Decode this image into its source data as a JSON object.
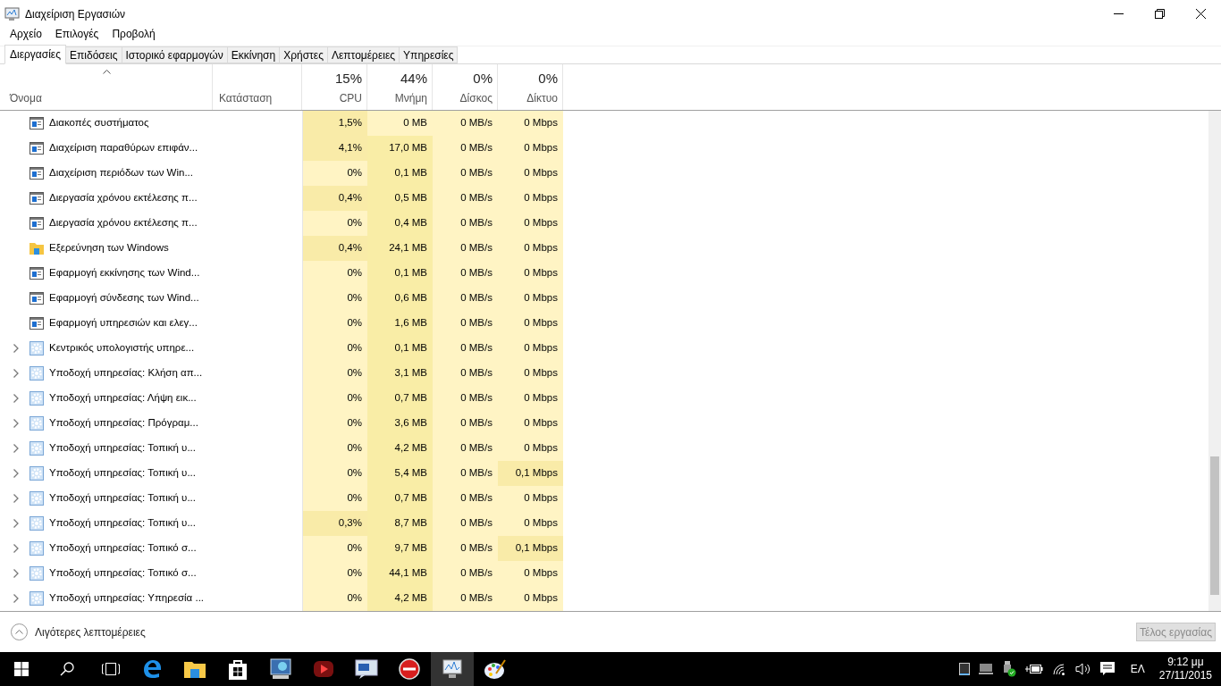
{
  "window": {
    "title": "Διαχείριση Εργασιών"
  },
  "menu": [
    "Αρχείο",
    "Επιλογές",
    "Προβολή"
  ],
  "tabs": [
    {
      "label": "Διεργασίες",
      "selected": true
    },
    {
      "label": "Επιδόσεις",
      "selected": false
    },
    {
      "label": "Ιστορικό εφαρμογών",
      "selected": false
    },
    {
      "label": "Εκκίνηση",
      "selected": false
    },
    {
      "label": "Χρήστες",
      "selected": false
    },
    {
      "label": "Λεπτομέρειες",
      "selected": false
    },
    {
      "label": "Υπηρεσίες",
      "selected": false
    }
  ],
  "columns": [
    {
      "label": "Όνομα",
      "kind": "name"
    },
    {
      "label": "Κατάσταση",
      "kind": "status"
    },
    {
      "label": "CPU",
      "usage": "15%",
      "kind": "metric"
    },
    {
      "label": "Μνήμη",
      "usage": "44%",
      "kind": "metric"
    },
    {
      "label": "Δίσκος",
      "usage": "0%",
      "kind": "metric"
    },
    {
      "label": "Δίκτυο",
      "usage": "0%",
      "kind": "metric"
    }
  ],
  "rows": [
    {
      "kind": "window",
      "name": "Διακοπές συστήματος",
      "cells": [
        {
          "text": "1,5%",
          "highlighted": true
        },
        {
          "text": "0 MB",
          "highlighted": false
        },
        {
          "text": "0 MB/s",
          "highlighted": false
        },
        {
          "text": "0 Mbps",
          "highlighted": false
        }
      ]
    },
    {
      "kind": "window",
      "name": "Διαχείριση παραθύρων επιφάν...",
      "cells": [
        {
          "text": "4,1%",
          "highlighted": true
        },
        {
          "text": "17,0 MB",
          "highlighted": true
        },
        {
          "text": "0 MB/s",
          "highlighted": false
        },
        {
          "text": "0 Mbps",
          "highlighted": false
        }
      ]
    },
    {
      "kind": "window",
      "name": "Διαχείριση περιόδων των Win...",
      "cells": [
        {
          "text": "0%",
          "highlighted": false
        },
        {
          "text": "0,1 MB",
          "highlighted": true
        },
        {
          "text": "0 MB/s",
          "highlighted": false
        },
        {
          "text": "0 Mbps",
          "highlighted": false
        }
      ]
    },
    {
      "kind": "window",
      "name": "Διεργασία χρόνου εκτέλεσης π...",
      "cells": [
        {
          "text": "0,4%",
          "highlighted": true
        },
        {
          "text": "0,5 MB",
          "highlighted": true
        },
        {
          "text": "0 MB/s",
          "highlighted": false
        },
        {
          "text": "0 Mbps",
          "highlighted": false
        }
      ]
    },
    {
      "kind": "window",
      "name": "Διεργασία χρόνου εκτέλεσης π...",
      "cells": [
        {
          "text": "0%",
          "highlighted": false
        },
        {
          "text": "0,4 MB",
          "highlighted": true
        },
        {
          "text": "0 MB/s",
          "highlighted": false
        },
        {
          "text": "0 Mbps",
          "highlighted": false
        }
      ]
    },
    {
      "kind": "folder",
      "name": "Εξερεύνηση των Windows",
      "cells": [
        {
          "text": "0,4%",
          "highlighted": true
        },
        {
          "text": "24,1 MB",
          "highlighted": true
        },
        {
          "text": "0 MB/s",
          "highlighted": false
        },
        {
          "text": "0 Mbps",
          "highlighted": false
        }
      ]
    },
    {
      "kind": "window",
      "name": "Εφαρμογή εκκίνησης των Wind...",
      "cells": [
        {
          "text": "0%",
          "highlighted": false
        },
        {
          "text": "0,1 MB",
          "highlighted": true
        },
        {
          "text": "0 MB/s",
          "highlighted": false
        },
        {
          "text": "0 Mbps",
          "highlighted": false
        }
      ]
    },
    {
      "kind": "window",
      "name": "Εφαρμογή σύνδεσης των Wind...",
      "cells": [
        {
          "text": "0%",
          "highlighted": false
        },
        {
          "text": "0,6 MB",
          "highlighted": true
        },
        {
          "text": "0 MB/s",
          "highlighted": false
        },
        {
          "text": "0 Mbps",
          "highlighted": false
        }
      ]
    },
    {
      "kind": "window",
      "name": "Εφαρμογή υπηρεσιών και ελεγ...",
      "cells": [
        {
          "text": "0%",
          "highlighted": false
        },
        {
          "text": "1,6 MB",
          "highlighted": true
        },
        {
          "text": "0 MB/s",
          "highlighted": false
        },
        {
          "text": "0 Mbps",
          "highlighted": false
        }
      ]
    },
    {
      "kind": "service",
      "expanded": false,
      "name": "Κεντρικός υπολογιστής υπηρε...",
      "cells": [
        {
          "text": "0%",
          "highlighted": false
        },
        {
          "text": "0,1 MB",
          "highlighted": true
        },
        {
          "text": "0 MB/s",
          "highlighted": false
        },
        {
          "text": "0 Mbps",
          "highlighted": false
        }
      ]
    },
    {
      "kind": "service",
      "expanded": false,
      "name": "Υποδοχή υπηρεσίας: Κλήση απ...",
      "cells": [
        {
          "text": "0%",
          "highlighted": false
        },
        {
          "text": "3,1 MB",
          "highlighted": true
        },
        {
          "text": "0 MB/s",
          "highlighted": false
        },
        {
          "text": "0 Mbps",
          "highlighted": false
        }
      ]
    },
    {
      "kind": "service",
      "expanded": false,
      "name": "Υποδοχή υπηρεσίας: Λήψη εικ...",
      "cells": [
        {
          "text": "0%",
          "highlighted": false
        },
        {
          "text": "0,7 MB",
          "highlighted": true
        },
        {
          "text": "0 MB/s",
          "highlighted": false
        },
        {
          "text": "0 Mbps",
          "highlighted": false
        }
      ]
    },
    {
      "kind": "service",
      "expanded": false,
      "name": "Υποδοχή υπηρεσίας: Πρόγραμ...",
      "cells": [
        {
          "text": "0%",
          "highlighted": false
        },
        {
          "text": "3,6 MB",
          "highlighted": true
        },
        {
          "text": "0 MB/s",
          "highlighted": false
        },
        {
          "text": "0 Mbps",
          "highlighted": false
        }
      ]
    },
    {
      "kind": "service",
      "expanded": false,
      "name": "Υποδοχή υπηρεσίας: Τοπική υ...",
      "cells": [
        {
          "text": "0%",
          "highlighted": false
        },
        {
          "text": "4,2 MB",
          "highlighted": true
        },
        {
          "text": "0 MB/s",
          "highlighted": false
        },
        {
          "text": "0 Mbps",
          "highlighted": false
        }
      ]
    },
    {
      "kind": "service",
      "expanded": false,
      "name": "Υποδοχή υπηρεσίας: Τοπική υ...",
      "cells": [
        {
          "text": "0%",
          "highlighted": false
        },
        {
          "text": "5,4 MB",
          "highlighted": true
        },
        {
          "text": "0 MB/s",
          "highlighted": false
        },
        {
          "text": "0,1 Mbps",
          "highlighted": true
        }
      ]
    },
    {
      "kind": "service",
      "expanded": false,
      "name": "Υποδοχή υπηρεσίας: Τοπική υ...",
      "cells": [
        {
          "text": "0%",
          "highlighted": false
        },
        {
          "text": "0,7 MB",
          "highlighted": true
        },
        {
          "text": "0 MB/s",
          "highlighted": false
        },
        {
          "text": "0 Mbps",
          "highlighted": false
        }
      ]
    },
    {
      "kind": "service",
      "expanded": false,
      "name": "Υποδοχή υπηρεσίας: Τοπική υ...",
      "cells": [
        {
          "text": "0,3%",
          "highlighted": true
        },
        {
          "text": "8,7 MB",
          "highlighted": true
        },
        {
          "text": "0 MB/s",
          "highlighted": false
        },
        {
          "text": "0 Mbps",
          "highlighted": false
        }
      ]
    },
    {
      "kind": "service",
      "expanded": false,
      "name": "Υποδοχή υπηρεσίας: Τοπικό σ...",
      "cells": [
        {
          "text": "0%",
          "highlighted": false
        },
        {
          "text": "9,7 MB",
          "highlighted": true
        },
        {
          "text": "0 MB/s",
          "highlighted": false
        },
        {
          "text": "0,1 Mbps",
          "highlighted": true
        }
      ]
    },
    {
      "kind": "service",
      "expanded": false,
      "name": "Υποδοχή υπηρεσίας: Τοπικό σ...",
      "cells": [
        {
          "text": "0%",
          "highlighted": false
        },
        {
          "text": "44,1 MB",
          "highlighted": true
        },
        {
          "text": "0 MB/s",
          "highlighted": false
        },
        {
          "text": "0 Mbps",
          "highlighted": false
        }
      ]
    },
    {
      "kind": "service",
      "expanded": false,
      "name": "Υποδοχή υπηρεσίας: Υπηρεσία ...",
      "cells": [
        {
          "text": "0%",
          "highlighted": false
        },
        {
          "text": "4,2 MB",
          "highlighted": true
        },
        {
          "text": "0 MB/s",
          "highlighted": false
        },
        {
          "text": "0 Mbps",
          "highlighted": false
        }
      ]
    }
  ],
  "footer": {
    "details_toggle": "Λιγότερες λεπτομέρειες",
    "end_task_button": {
      "label": "Τέλος εργασίας",
      "disabled": true
    }
  },
  "taskbar": {
    "apps": [
      {
        "kind": "edge",
        "active": false
      },
      {
        "kind": "folder",
        "active": false
      },
      {
        "kind": "store",
        "active": false
      },
      {
        "kind": "remote",
        "active": false
      },
      {
        "kind": "media",
        "active": false
      },
      {
        "kind": "chat",
        "active": false
      },
      {
        "kind": "nero",
        "active": false
      },
      {
        "kind": "monitor",
        "active": true
      },
      {
        "kind": "paint",
        "active": false
      }
    ],
    "language": "ΕΛ",
    "time": "9:12 μμ",
    "date": "27/11/2015"
  }
}
